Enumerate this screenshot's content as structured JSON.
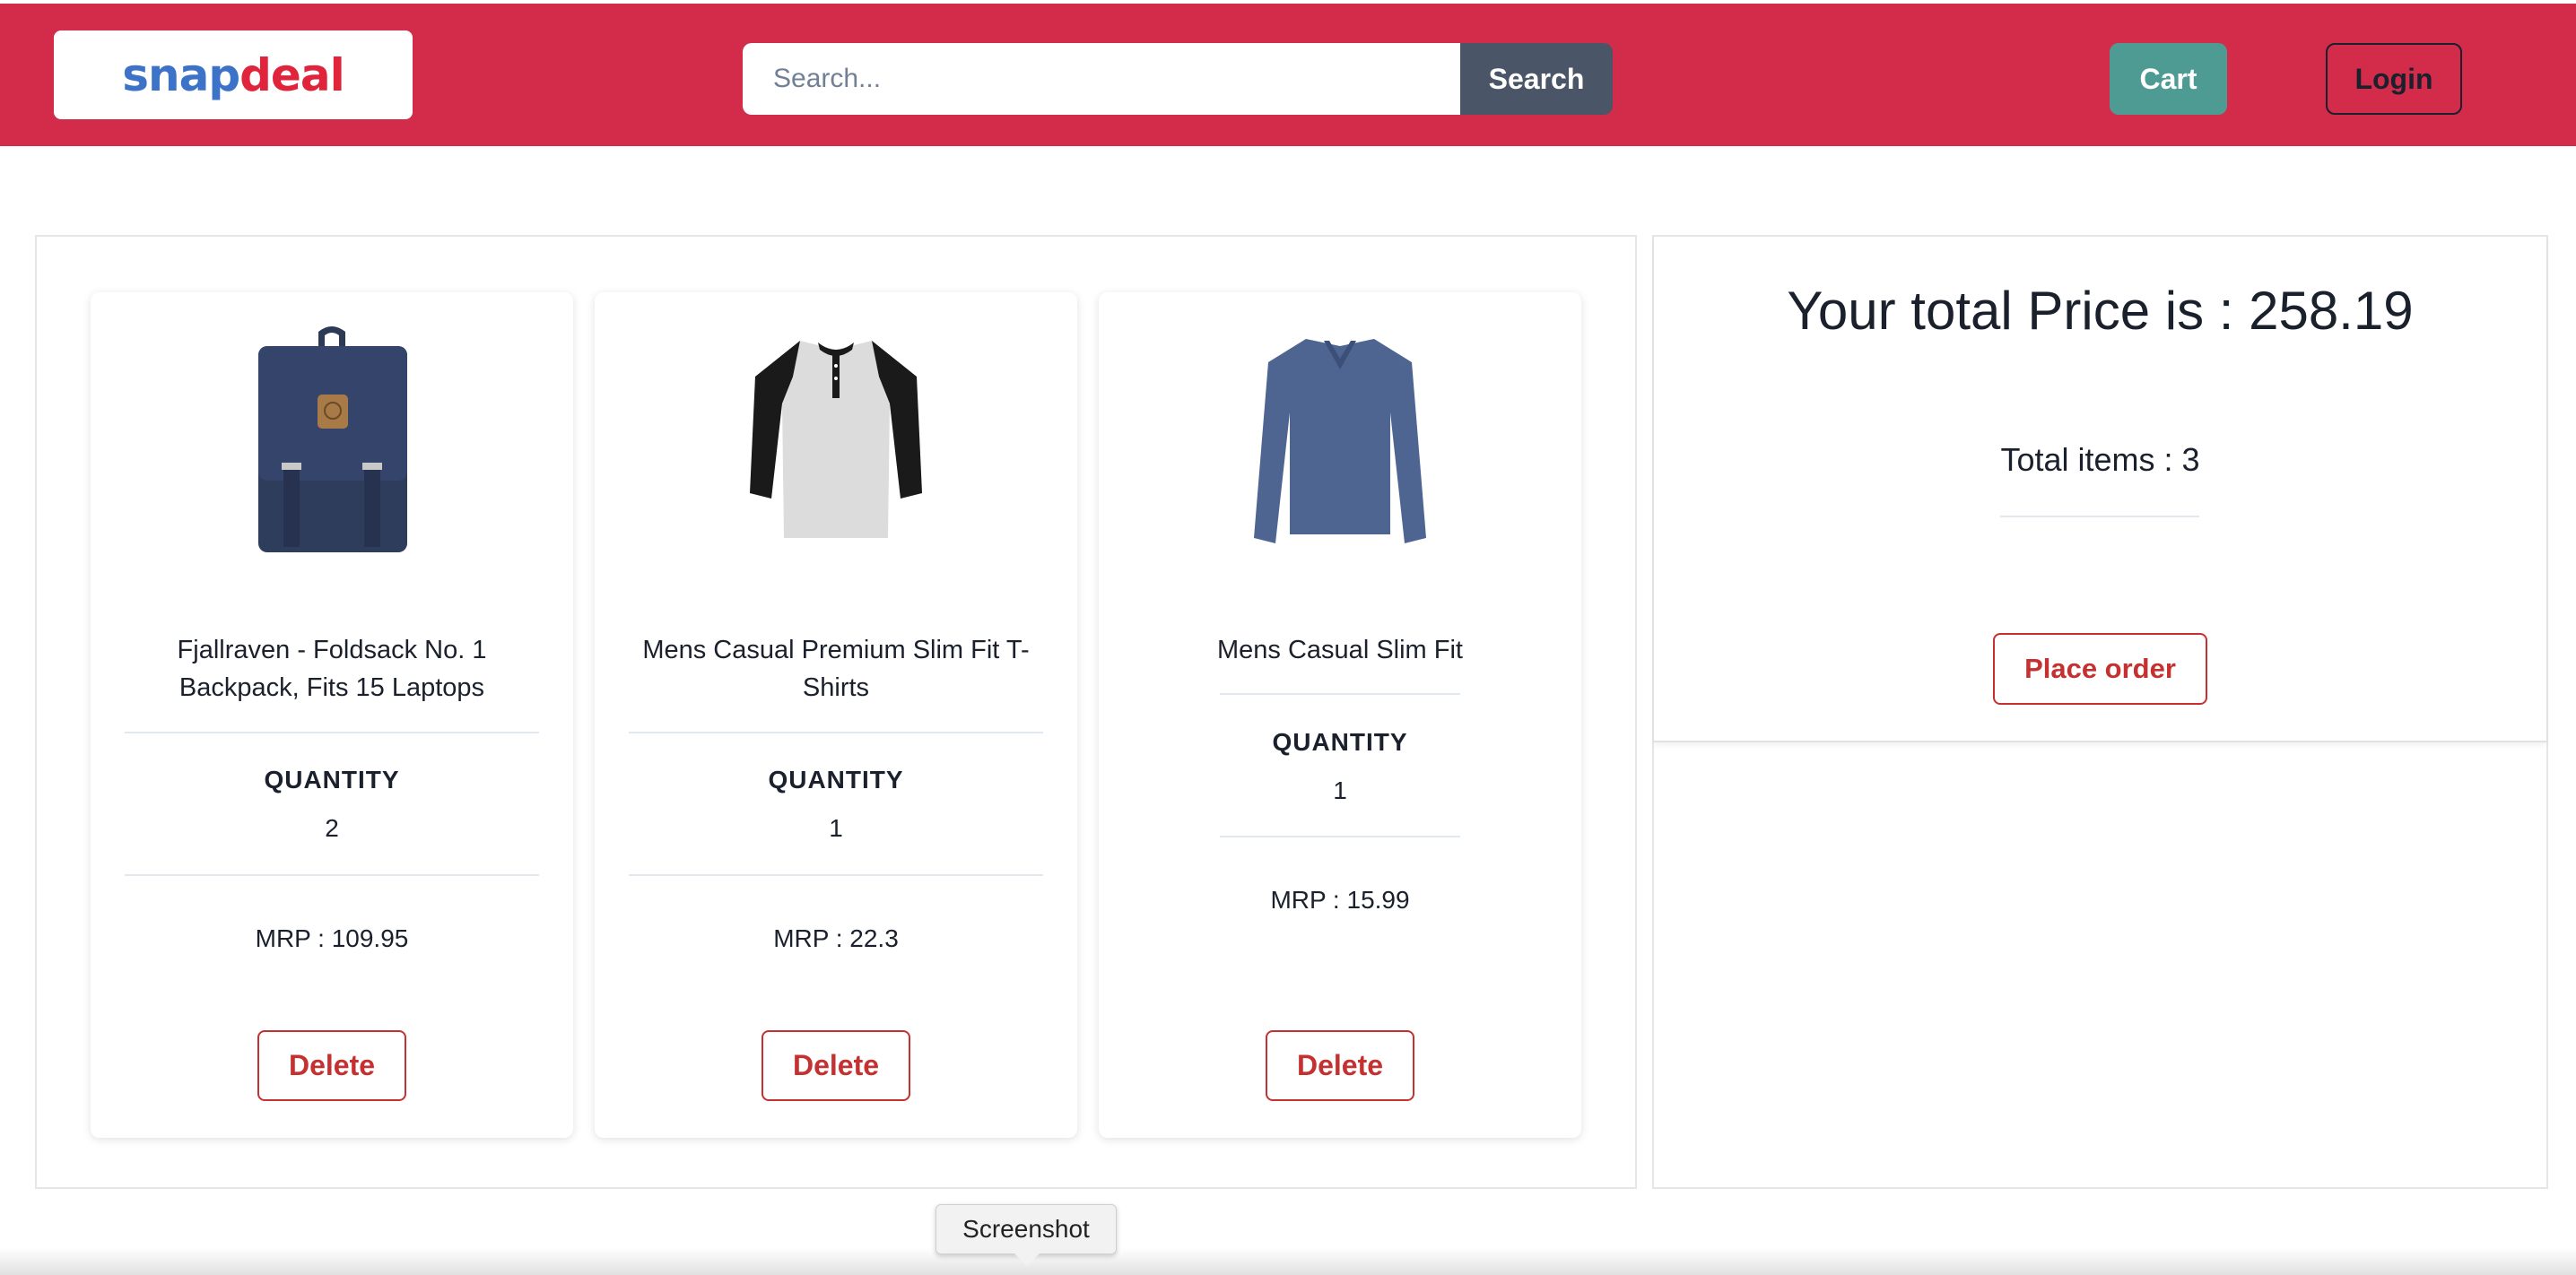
{
  "header": {
    "logo_snap": "snap",
    "logo_deal": "deal",
    "search_placeholder": "Search...",
    "search_value": "",
    "search_button": "Search",
    "cart_button": "Cart",
    "login_button": "Login"
  },
  "cart": {
    "quantity_label": "QUANTITY",
    "delete_label": "Delete",
    "items": [
      {
        "title": "Fjallraven - Foldsack No. 1 Backpack, Fits 15 Laptops",
        "quantity": "2",
        "mrp": "MRP : 109.95",
        "icon": "backpack-image"
      },
      {
        "title": "Mens Casual Premium Slim Fit T-Shirts",
        "quantity": "1",
        "mrp": "MRP : 22.3",
        "icon": "raglan-tshirt-image"
      },
      {
        "title": "Mens Casual Slim Fit",
        "quantity": "1",
        "mrp": "MRP : 15.99",
        "icon": "long-sleeve-shirt-image"
      }
    ]
  },
  "summary": {
    "total_price": "Your total Price is : 258.19",
    "total_items": "Total items : 3",
    "place_order": "Place order"
  },
  "tooltip": {
    "text": "Screenshot"
  },
  "colors": {
    "navbar": "#d32c4b",
    "search_button": "#4a5568",
    "cart_button": "#4e9b94",
    "danger": "#c53030"
  }
}
